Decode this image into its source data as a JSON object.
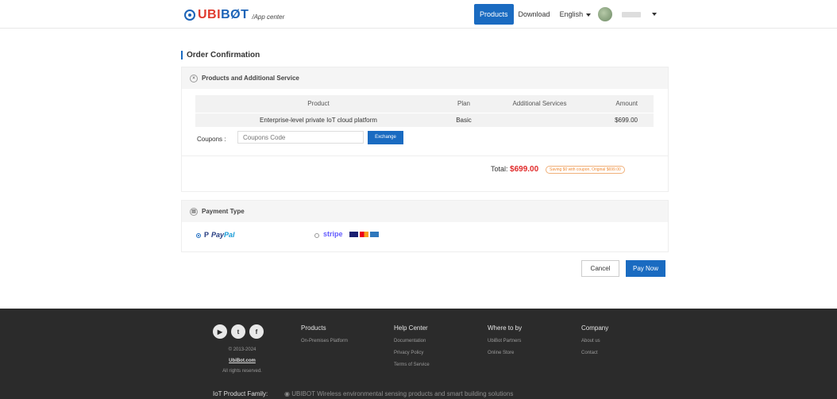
{
  "header": {
    "logo_text_ubi": "UBI",
    "logo_text_bot": "BØT",
    "logo_sub": "/App center",
    "nav": [
      "Products",
      "Download"
    ],
    "language": "English"
  },
  "page_title": "Order Confirmation",
  "products_section": {
    "title": "Products and Additional Service",
    "columns": [
      "Product",
      "Plan",
      "Additional Services",
      "Amount"
    ],
    "rows": [
      {
        "product": "Enterprise-level private IoT cloud platform",
        "plan": "Basic",
        "services": "",
        "amount": "$699.00"
      }
    ],
    "coupon_label": "Coupons :",
    "coupon_placeholder": "Coupons Code",
    "exchange_label": "Exchange",
    "total_label": "Total:",
    "total_amount": "$699.00",
    "saving_note": "Saving $0 with coupon, Original $699.00"
  },
  "payment_section": {
    "title": "Payment Type",
    "options": [
      {
        "name_a": "Pay",
        "name_b": "Pal",
        "selected": true
      },
      {
        "name": "stripe",
        "selected": false
      }
    ]
  },
  "actions": {
    "cancel": "Cancel",
    "pay": "Pay Now"
  },
  "footer": {
    "social_icons": [
      "youtube-icon",
      "twitter-icon",
      "facebook-icon"
    ],
    "copyright": "© 2013-2024",
    "site": "UbiBot.com",
    "rights": "All rights reserved.",
    "columns": [
      {
        "heading": "Products",
        "links": [
          "On-Premises Platform"
        ]
      },
      {
        "heading": "Help Center",
        "links": [
          "Documentation",
          "Privacy Policy",
          "Terms of Service"
        ]
      },
      {
        "heading": "Where to by",
        "links": [
          "UbiBot Partners",
          "Online Store"
        ]
      },
      {
        "heading": "Company",
        "links": [
          "About us",
          "Contact"
        ]
      }
    ],
    "family_label": "IoT Product Family:",
    "family_brand": "UBIBOT",
    "family_text": "Wireless environmental sensing products and smart building solutions"
  },
  "colors": {
    "brand": "#1a6bc1",
    "price": "#e12a2a",
    "footer_bg": "#2b2b2b"
  }
}
